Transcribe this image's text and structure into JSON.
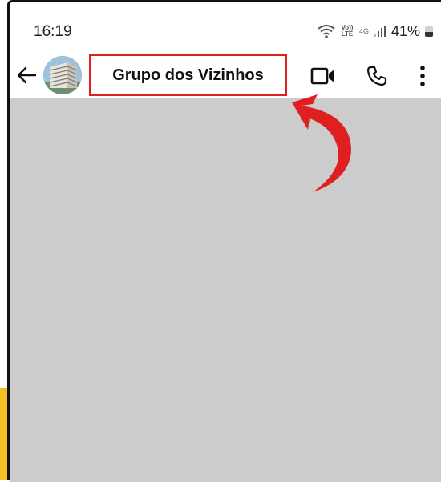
{
  "status_bar": {
    "time": "16:19",
    "volte_label": "Vo)) LTE",
    "network": "4G",
    "battery_pct": "41%"
  },
  "toolbar": {
    "title": "Grupo dos Vizinhos",
    "icons": [
      "back-arrow-icon",
      "group-avatar",
      "video-call-icon",
      "phone-call-icon",
      "more-options-icon"
    ]
  },
  "colors": {
    "chat_background": "#cccccc",
    "highlight_border": "#e02020",
    "annotation_arrow": "#e02020",
    "accent_yellow": "#f4c025"
  }
}
